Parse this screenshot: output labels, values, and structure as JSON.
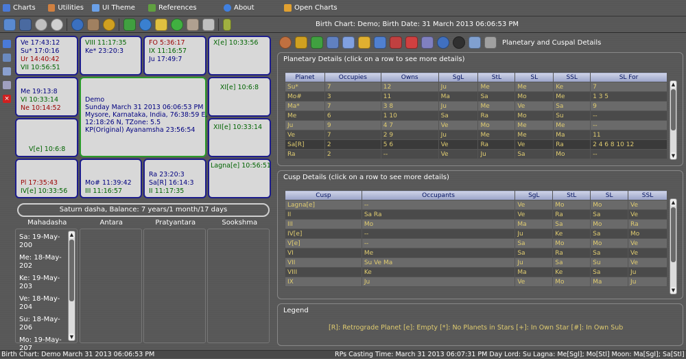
{
  "menu": [
    {
      "label": "Charts",
      "icon": "grid-icon",
      "color": "#4a7ad8"
    },
    {
      "label": "Utilities",
      "icon": "utilities-icon",
      "color": "#d08040"
    },
    {
      "label": "UI Theme",
      "icon": "monitor-icon",
      "color": "#6aa0e8"
    },
    {
      "label": "References",
      "icon": "book-icon",
      "color": "#60a040"
    },
    {
      "label": "About",
      "icon": "info-icon",
      "color": "#4080e0"
    },
    {
      "label": "Open Charts",
      "icon": "open-charts-icon",
      "color": "#e0a030"
    }
  ],
  "toolbar": {
    "birth_line": "Birth Chart: Demo; Birth Date: 31 March 2013 06:06:53 PM",
    "icons": [
      "people-icon",
      "person-icon",
      "clock-icon",
      "stopwatch-icon",
      "globe-icon",
      "walk-icon",
      "rings-icon",
      "star-icon",
      "earth-icon",
      "star-trail-icon",
      "refresh-icon",
      "tools-icon",
      "settings-icon",
      "book-icon"
    ],
    "colors": [
      "#5a8ad0",
      "#4a6aa0",
      "#c0c0c0",
      "#d0d0d0",
      "#3a70c0",
      "#a08060",
      "#d0a020",
      "#40a040",
      "#3a80d0",
      "#e0c040",
      "#40b040",
      "#b0a090",
      "#c0c0c0",
      "#a0b040"
    ]
  },
  "left_icons": [
    {
      "name": "save-icon",
      "color": "#4a7ad8"
    },
    {
      "name": "edit-icon",
      "color": "#6a8ac0"
    },
    {
      "name": "document-icon",
      "color": "#8aa0d0"
    },
    {
      "name": "print-icon",
      "color": "#a0a0c0"
    },
    {
      "name": "close-icon",
      "color": "#d02020"
    }
  ],
  "chart": {
    "cells": [
      {
        "lines": [
          {
            "t": "Ve 17:43:12",
            "c": "blue"
          },
          {
            "t": "Su* 17:0:16",
            "c": "blue"
          },
          {
            "t": "Ur 14:40:42",
            "c": "red"
          },
          {
            "t": "VII 10:56:51",
            "c": "green"
          }
        ]
      },
      {
        "lines": [
          {
            "t": "VIII 11:17:35",
            "c": "green"
          },
          {
            "t": "Ke* 23:20:3",
            "c": "blue"
          }
        ]
      },
      {
        "lines": [
          {
            "t": "FO 5:36:17",
            "c": "red"
          },
          {
            "t": "IX 11:16:57",
            "c": "green"
          },
          {
            "t": "Ju 17:49:7",
            "c": "blue"
          }
        ]
      },
      {
        "lines": [
          {
            "t": "X[e] 10:33:56",
            "c": "green"
          }
        ]
      },
      {
        "lines": [
          {
            "t": "Me 19:13:8",
            "c": "blue"
          },
          {
            "t": "VI 10:33:14",
            "c": "green"
          },
          {
            "t": "Ne 10:14:52",
            "c": "red"
          }
        ]
      },
      {
        "lines": [
          {
            "t": "XI[e] 10:6:8",
            "c": "green"
          }
        ]
      },
      {
        "lines": [
          {
            "t": "V[e] 10:6:8",
            "c": "green"
          }
        ]
      },
      {
        "lines": [
          {
            "t": "XII[e] 10:33:14",
            "c": "green"
          }
        ]
      },
      {
        "lines": [
          {
            "t": "Pl 17:35:43",
            "c": "red"
          },
          {
            "t": "IV[e] 10:33:56",
            "c": "green"
          }
        ]
      },
      {
        "lines": [
          {
            "t": "Mo# 11:39:42",
            "c": "blue"
          },
          {
            "t": "III 11:16:57",
            "c": "green"
          }
        ]
      },
      {
        "lines": [
          {
            "t": "Ra 23:20:3",
            "c": "blue"
          },
          {
            "t": "Sa[R] 16:14:3",
            "c": "blue"
          },
          {
            "t": "II 11:17:35",
            "c": "green"
          }
        ]
      },
      {
        "lines": [
          {
            "t": "Lagna[e] 10:56:51",
            "c": "green"
          }
        ]
      }
    ],
    "center": [
      "Demo",
      "Sunday March 31 2013  06:06:53 PM",
      "Mysore, Karnataka, India, 76:38:59 E,",
      "12:18:26 N, TZone: 5.5",
      "KP(Original) Ayanamsha 23:56:54"
    ]
  },
  "dasha": {
    "balance": "Saturn dasha, Balance: 7 years/1 month/17 days",
    "headers": [
      "Mahadasha",
      "Antara",
      "Pratyantara",
      "Sookshma"
    ],
    "mahadasha": [
      "Sa: 19-May-200",
      "Me: 18-May-202",
      "Ke: 19-May-203",
      "Ve: 18-May-204",
      "Su: 18-May-206",
      "Mo: 19-May-207"
    ]
  },
  "right_toolbar": {
    "title": "Planetary and Cuspal Details",
    "colors": [
      "#c07040",
      "#d0a020",
      "#40a040",
      "#6080c0",
      "#80a0e0",
      "#e0b030",
      "#5080d0",
      "#c04040",
      "#d04040",
      "#8080c0",
      "#4070c0",
      "#303030",
      "#80a0d0",
      "#a0a0a0"
    ]
  },
  "planetary": {
    "title": "Planetary Details (click on a row to see more details)",
    "headers": [
      "Planet",
      "Occupies",
      "Owns",
      "SgL",
      "StL",
      "SL",
      "SSL",
      "SL For"
    ],
    "rows": [
      [
        "Su*",
        "7",
        "12",
        "Ju",
        "Me",
        "Me",
        "Ke",
        "7"
      ],
      [
        "Mo#",
        "3",
        "11",
        "Ma",
        "Sa",
        "Mo",
        "Me",
        "1  3  5"
      ],
      [
        "Ma*",
        "7",
        "3  8",
        "Ju",
        "Me",
        "Ve",
        "Sa",
        "9"
      ],
      [
        "Me",
        "6",
        "1  10",
        "Sa",
        "Ra",
        "Mo",
        "Su",
        "--"
      ],
      [
        "Ju",
        "9",
        "4  7",
        "Ve",
        "Mo",
        "Me",
        "Me",
        "--"
      ],
      [
        "Ve",
        "7",
        "2  9",
        "Ju",
        "Me",
        "Me",
        "Ma",
        "11"
      ],
      [
        "Sa[R]",
        "2",
        "5  6",
        "Ve",
        "Ra",
        "Ve",
        "Ra",
        "2  4  6  8  10  12"
      ],
      [
        "Ra",
        "2",
        "--",
        "Ve",
        "Ju",
        "Sa",
        "Mo",
        "--"
      ]
    ]
  },
  "cusp": {
    "title": "Cusp Details (click on a row to see more details)",
    "headers": [
      "Cusp",
      "Occupants",
      "SgL",
      "StL",
      "SL",
      "SSL"
    ],
    "rows": [
      [
        "Lagna[e]",
        "--",
        "Ve",
        "Mo",
        "Mo",
        "Ve"
      ],
      [
        "II",
        "Sa Ra",
        "Ve",
        "Ra",
        "Sa",
        "Ve"
      ],
      [
        "III",
        "Mo",
        "Ma",
        "Sa",
        "Mo",
        "Ra"
      ],
      [
        "IV[e]",
        "--",
        "Ju",
        "Ke",
        "Sa",
        "Mo"
      ],
      [
        "V[e]",
        "--",
        "Sa",
        "Mo",
        "Mo",
        "Ve"
      ],
      [
        "VI",
        "Me",
        "Sa",
        "Ra",
        "Sa",
        "Ve"
      ],
      [
        "VII",
        "Su Ve Ma",
        "Ju",
        "Sa",
        "Su",
        "Ve"
      ],
      [
        "VIII",
        "Ke",
        "Ma",
        "Ke",
        "Sa",
        "Ju"
      ],
      [
        "IX",
        "Ju",
        "Ve",
        "Mo",
        "Ma",
        "Ju"
      ]
    ]
  },
  "legend": {
    "title": "Legend",
    "text": "[R]:  Retrograde Planet  [e]:  Empty  [*]:  No Planets in Stars  [+]:  In Own Star  [#]:  In Own Sub"
  },
  "status": {
    "left": "Birth Chart: Demo March 31 2013 06:06:53 PM",
    "right": "RPs Casting Time: March 31 2013 06:07:31 PM  Day Lord: Su  Lagna: Me[Sgl]; Mo[Stl]   Moon: Ma[Sgl]; Sa[Stl]"
  }
}
